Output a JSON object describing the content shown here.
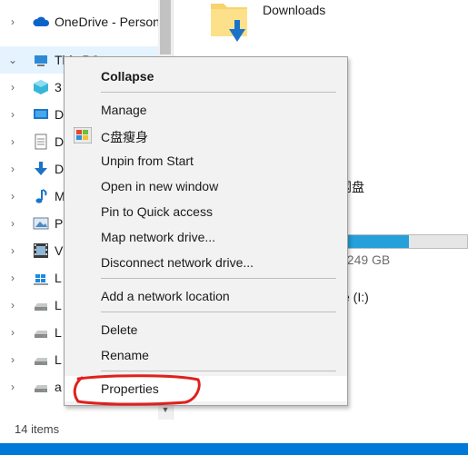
{
  "nav": {
    "items": [
      {
        "label": "OneDrive - Person",
        "icon": "onedrive-icon",
        "chevron": "›"
      },
      {
        "label": "This PC",
        "icon": "computer-icon",
        "chevron": "⌄"
      },
      {
        "label": "3",
        "icon": "3d-objects-icon",
        "chevron": "›"
      },
      {
        "label": "D",
        "icon": "desktop-icon",
        "chevron": "›"
      },
      {
        "label": "D",
        "icon": "documents-icon",
        "chevron": "›"
      },
      {
        "label": "D",
        "icon": "downloads-icon",
        "chevron": "›"
      },
      {
        "label": "M",
        "icon": "music-icon",
        "chevron": "›"
      },
      {
        "label": "P",
        "icon": "pictures-icon",
        "chevron": "›"
      },
      {
        "label": "V",
        "icon": "videos-icon",
        "chevron": "›"
      },
      {
        "label": "L",
        "icon": "windows-drive-icon",
        "chevron": "›"
      },
      {
        "label": "L",
        "icon": "drive-icon",
        "chevron": "›"
      },
      {
        "label": "L",
        "icon": "drive-icon",
        "chevron": "›"
      },
      {
        "label": "L",
        "icon": "drive-icon",
        "chevron": "›"
      },
      {
        "label": "a",
        "icon": "drive-icon",
        "chevron": "›"
      }
    ]
  },
  "content": {
    "downloads_label": "Downloads",
    "drive_name": "网盘",
    "drive_free": "f 249 GB",
    "drive_fill_fraction": 0.52,
    "drive_i": "e (I:)"
  },
  "status": {
    "count": "14 items"
  },
  "menu": {
    "collapse": "Collapse",
    "manage": "Manage",
    "c_slim": "C盘瘦身",
    "unpin": "Unpin from Start",
    "open_new_window": "Open in new window",
    "pin_quick": "Pin to Quick access",
    "map_drive": "Map network drive...",
    "disconnect_drive": "Disconnect network drive...",
    "add_location": "Add a network location",
    "delete": "Delete",
    "rename": "Rename",
    "properties": "Properties"
  },
  "colors": {
    "accent": "#0078d7",
    "selection": "#e5f3ff",
    "annotation": "#e0201c"
  }
}
